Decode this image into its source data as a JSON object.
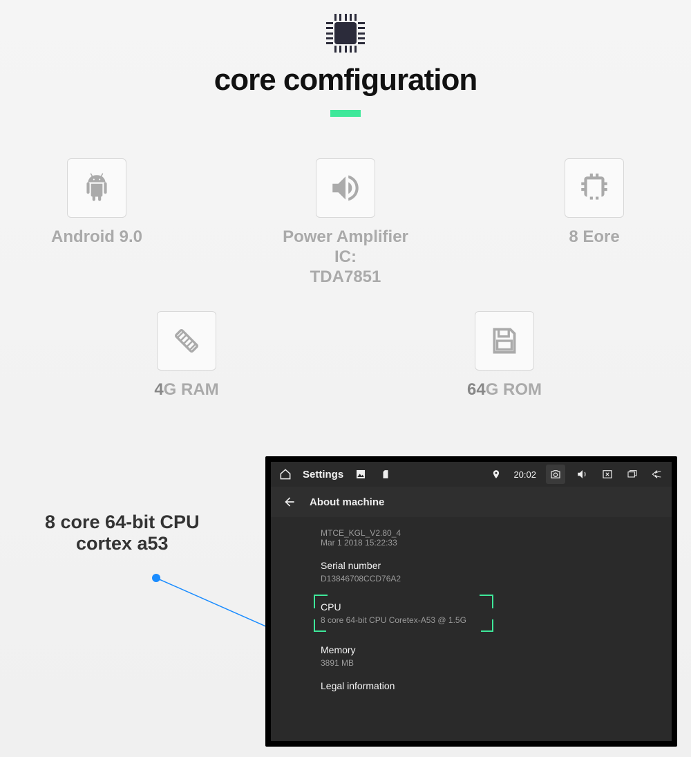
{
  "header": {
    "title": "core comfiguration"
  },
  "specs": {
    "row1": [
      {
        "label": "Android 9.0",
        "icon": "android-icon"
      },
      {
        "label": "Power Amplifier IC:\nTDA7851",
        "icon": "speaker-icon"
      },
      {
        "label": "8 Eore",
        "icon": "cpu-chip-icon"
      }
    ],
    "row2": [
      {
        "prefix": "4",
        "label": "G RAM",
        "icon": "ram-icon"
      },
      {
        "prefix": "64",
        "label": "G ROM",
        "icon": "storage-icon"
      }
    ]
  },
  "callout": {
    "line1": "8 core 64-bit CPU",
    "line2": "cortex a53"
  },
  "device": {
    "statusbar": {
      "title": "Settings",
      "time": "20:02"
    },
    "subhead": "About machine",
    "version": {
      "line1": "MTCE_KGL_V2.80_4",
      "line2": "Mar  1 2018 15:22:33"
    },
    "serial": {
      "title": "Serial number",
      "value": "D13846708CCD76A2"
    },
    "cpu": {
      "title": "CPU",
      "value": "8 core 64-bit CPU Coretex-A53 @ 1.5G"
    },
    "memory": {
      "title": "Memory",
      "value": "3891 MB"
    },
    "legal": {
      "title": "Legal information"
    }
  }
}
